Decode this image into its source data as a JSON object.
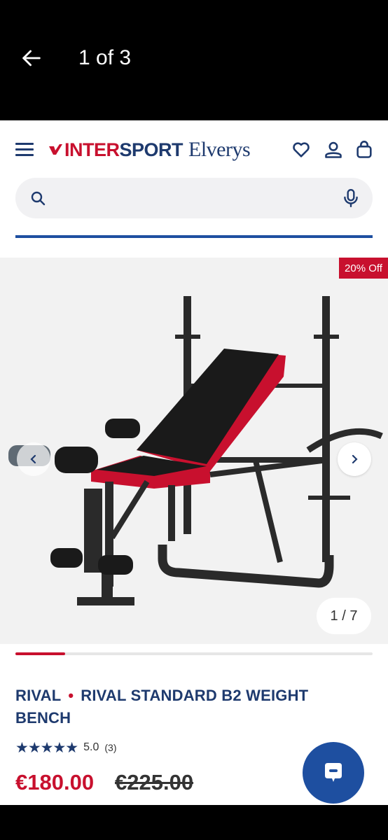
{
  "viewer": {
    "counter": "1 of 3"
  },
  "header": {
    "logo_inter": "INTER",
    "logo_sport": "SPORT",
    "logo_elverys": "Elverys"
  },
  "search": {
    "placeholder": ""
  },
  "gallery": {
    "badge": "20% Off",
    "page_indicator": "1 / 7",
    "progress_fraction": 0.14
  },
  "product": {
    "brand": "RIVAL",
    "separator": "•",
    "name": "RIVAL STANDARD B2 WEIGHT BENCH",
    "stars": "★★★★★",
    "rating": "5.0",
    "rating_count": "(3)",
    "price": "€180.00",
    "old_price": "€225.00"
  },
  "colors": {
    "brand_blue": "#1e3a6e",
    "accent_blue": "#1e4fa0",
    "brand_red": "#c8102e"
  },
  "icons": [
    "back-arrow-icon",
    "hamburger-icon",
    "heart-icon",
    "user-icon",
    "bag-icon",
    "search-icon",
    "microphone-icon",
    "chevron-left-icon",
    "chevron-right-icon",
    "chat-icon"
  ]
}
